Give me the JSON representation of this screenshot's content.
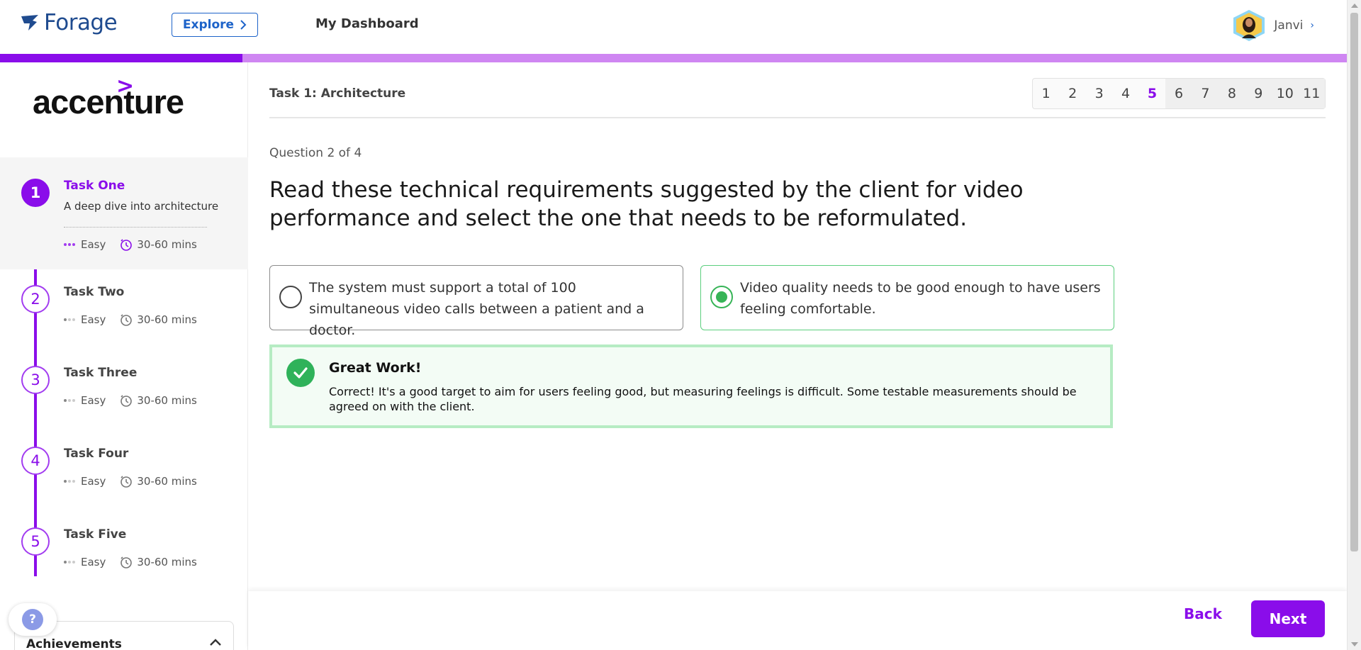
{
  "header": {
    "brand": "Forage",
    "explore_label": "Explore",
    "dashboard_label": "My Dashboard",
    "user_name": "Janvi",
    "user_chevron": "›"
  },
  "progress": {
    "fraction": 0.18
  },
  "sidebar": {
    "company": "accenture",
    "company_mark": ">",
    "tasks": [
      {
        "num": "1",
        "title": "Task One",
        "desc": "A deep dive into architecture",
        "difficulty": "Easy",
        "duration": "30-60 mins"
      },
      {
        "num": "2",
        "title": "Task Two",
        "difficulty": "Easy",
        "duration": "30-60 mins"
      },
      {
        "num": "3",
        "title": "Task Three",
        "difficulty": "Easy",
        "duration": "30-60 mins"
      },
      {
        "num": "4",
        "title": "Task Four",
        "difficulty": "Easy",
        "duration": "30-60 mins"
      },
      {
        "num": "5",
        "title": "Task Five",
        "difficulty": "Easy",
        "duration": "30-60 mins"
      }
    ],
    "help_label": "?",
    "achievements_label": "Achievements"
  },
  "main": {
    "task_title": "Task 1: Architecture",
    "pages": [
      "1",
      "2",
      "3",
      "4",
      "5",
      "6",
      "7",
      "8",
      "9",
      "10",
      "11"
    ],
    "current_page": "5",
    "question_count": "Question 2 of 4",
    "question": "Read these technical requirements suggested by the client for video performance and select the one that needs to be reformulated.",
    "options": [
      {
        "text": "The system must support a total of 100 simultaneous video calls between a patient and a doctor.",
        "selected": false
      },
      {
        "text": "Video quality needs to be good enough to have users feeling comfortable.",
        "selected": true
      }
    ],
    "feedback": {
      "title": "Great Work!",
      "body": "Correct! It's a good target to aim for users feeling good, but measuring feelings is difficult. Some testable measurements should be agreed on with the client."
    },
    "back_label": "Back",
    "next_label": "Next"
  },
  "colors": {
    "brand_purple": "#8a0dea",
    "progress_track": "#cf86f2",
    "forage_blue": "#1f4b8f",
    "success_green": "#2fb25a",
    "success_bg": "#f3fcf5"
  },
  "icons": [
    "forage-logo-icon",
    "chevron-right-icon",
    "clock-icon",
    "check-icon",
    "chevron-up-icon",
    "help-icon"
  ]
}
